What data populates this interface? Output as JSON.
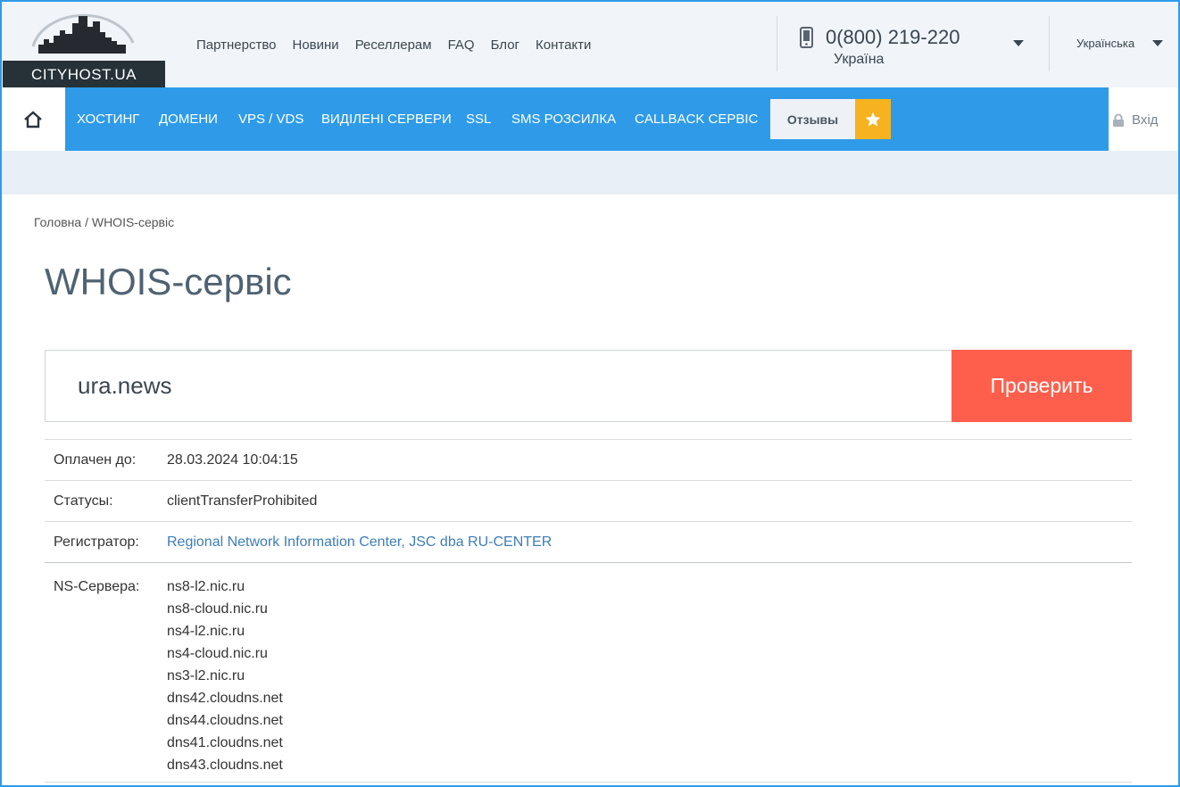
{
  "header": {
    "logo_text": "CITYHOST.UA",
    "top_nav": [
      "Партнерство",
      "Новини",
      "Реселлерам",
      "FAQ",
      "Блог",
      "Контакти"
    ],
    "phone": "0(800) 219-220",
    "phone_region": "Україна",
    "language": "Українська"
  },
  "main_nav": {
    "items": [
      "ХОСТИНГ",
      "ДОМЕНИ",
      "VPS / VDS",
      "ВИДІЛЕНІ СЕРВЕРИ",
      "SSL",
      "SMS РОЗСИЛКА",
      "CALLBACK СЕРВІС"
    ],
    "reviews_label": "Отзывы",
    "login_label": "Вхід"
  },
  "breadcrumb": "Головна / WHOIS-сервіс",
  "page_title": "WHOIS-сервіс",
  "search": {
    "value": "ura.news",
    "button_label": "Проверить"
  },
  "whois": {
    "paid_until_label": "Оплачен до:",
    "paid_until_value": "28.03.2024 10:04:15",
    "statuses_label": "Статусы:",
    "statuses_value": "clientTransferProhibited",
    "registrar_label": "Регистратор:",
    "registrar_value": "Regional Network Information Center, JSC dba RU-CENTER",
    "ns_label": "NS-Сервера:",
    "ns_servers": [
      "ns8-l2.nic.ru",
      "ns8-cloud.nic.ru",
      "ns4-l2.nic.ru",
      "ns4-cloud.nic.ru",
      "ns3-l2.nic.ru",
      "dns42.cloudns.net",
      "dns44.cloudns.net",
      "dns41.cloudns.net",
      "dns43.cloudns.net"
    ]
  },
  "colors": {
    "nav_blue": "#2f9be8",
    "button_red": "#fe5f4c",
    "star_yellow": "#f7b21f",
    "link_blue": "#3c7eb8"
  },
  "icons": [
    "home-icon",
    "phone-icon",
    "star-icon",
    "lock-icon",
    "chevron-down-icon",
    "city-skyline-logo"
  ]
}
